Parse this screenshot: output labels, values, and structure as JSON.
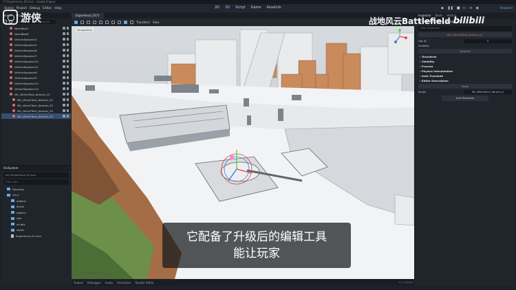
{
  "window": {
    "title": "[*] Experience_01.tscn - Godot Engine"
  },
  "menus": [
    "Scene",
    "Project",
    "Debug",
    "Editor",
    "Help"
  ],
  "main_screens": [
    {
      "label": "2D",
      "active": false
    },
    {
      "label": "3D",
      "active": true
    },
    {
      "label": "Script",
      "active": false
    },
    {
      "label": "Game",
      "active": false
    },
    {
      "label": "AssetLib",
      "active": false
    }
  ],
  "renderer": "Forward+",
  "left_dock": {
    "tabs": [
      "Scene",
      "Import"
    ],
    "filter_placeholder": "Filter: name, t:type, g:group",
    "tree": [
      {
        "name": "WorldBox7",
        "selected": false,
        "indent": false
      },
      {
        "name": "WorldBox8",
        "selected": false,
        "indent": false
      },
      {
        "name": "VehicleSpawner4",
        "selected": false,
        "indent": false
      },
      {
        "name": "VehicleSpawner5",
        "selected": false,
        "indent": false
      },
      {
        "name": "VehicleSpawner6",
        "selected": false,
        "indent": false
      },
      {
        "name": "VehicleSpawner7",
        "selected": false,
        "indent": false
      },
      {
        "name": "VehicleSpawner10",
        "selected": false,
        "indent": false
      },
      {
        "name": "VehicleSpawner11",
        "selected": false,
        "indent": false
      },
      {
        "name": "VehicleSpawner8",
        "selected": false,
        "indent": false
      },
      {
        "name": "VehicleSpawner9",
        "selected": false,
        "indent": false
      },
      {
        "name": "VehicleSpawner12",
        "selected": false,
        "indent": false
      },
      {
        "name": "VehicleSpawner13",
        "selected": false,
        "indent": false
      },
      {
        "name": "MIL_WreckTank_Abrams_01",
        "selected": false,
        "indent": false
      },
      {
        "name": "MIL_WreckTank_Abrams_02",
        "selected": false,
        "indent": true
      },
      {
        "name": "MIL_WreckTank_Abrams_03",
        "selected": false,
        "indent": true
      },
      {
        "name": "MIL_WreckTank_Abrams_04",
        "selected": false,
        "indent": true
      },
      {
        "name": "MIL_WreckTank_Abrams_05",
        "selected": true,
        "indent": true
      }
    ]
  },
  "filesystem": {
    "title": "FileSystem",
    "path": "res://Experience_01.tscn",
    "filter_placeholder": "Filter Files",
    "items": [
      {
        "name": "Favorites",
        "type": "folder",
        "sub": false
      },
      {
        "name": "res://",
        "type": "folder",
        "sub": false
      },
      {
        "name": "addons",
        "type": "folder",
        "sub": true
      },
      {
        "name": "levels",
        "type": "folder",
        "sub": true
      },
      {
        "name": "objects",
        "type": "folder",
        "sub": true
      },
      {
        "name": "raw",
        "type": "folder",
        "sub": true
      },
      {
        "name": "scripts",
        "type": "folder",
        "sub": true
      },
      {
        "name": "styles",
        "type": "folder",
        "sub": true
      },
      {
        "name": "Experience_01.tscn",
        "type": "file",
        "sub": true
      }
    ]
  },
  "viewport": {
    "tabs": [
      "Experience_01(*)"
    ],
    "toolbar": {
      "transform": "Transform",
      "view": "View"
    },
    "label": "Perspective",
    "fps": "FPS: 4.50 (222.2 ms)"
  },
  "bottom_panel": [
    "Output",
    "Debugger",
    "Audio",
    "Animation",
    "Shader Editor"
  ],
  "version": "4.4.1.stable",
  "inspector": {
    "tabs": [
      "Inspector",
      "Node",
      "History"
    ],
    "node_name": "MIL_WreckTank_Abrams_05",
    "filter_placeholder": "Filter Properties",
    "header_node": "MIL_WreckTank_Abrams_01",
    "props": [
      {
        "label": "Obj ID",
        "value": "5"
      },
      {
        "label": "Visibility",
        "value": ""
      }
    ],
    "sub_header": "Node3D",
    "sections": [
      "Transform",
      "Visibility",
      "Process",
      "Physics Interpolation",
      "Auto Translate",
      "Editor Description"
    ],
    "node_header": "Node",
    "script_label": "Script",
    "script_value": "MIL_WreckTank_Abrams_0",
    "add_metadata": "Add Metadata"
  },
  "overlay": {
    "subtitle_line1": "它配备了升级后的编辑工具",
    "subtitle_line2": "能让玩家",
    "watermark_left": "游侠",
    "watermark_right": "战地风云Battlefield",
    "watermark_brand": "bilibili"
  }
}
